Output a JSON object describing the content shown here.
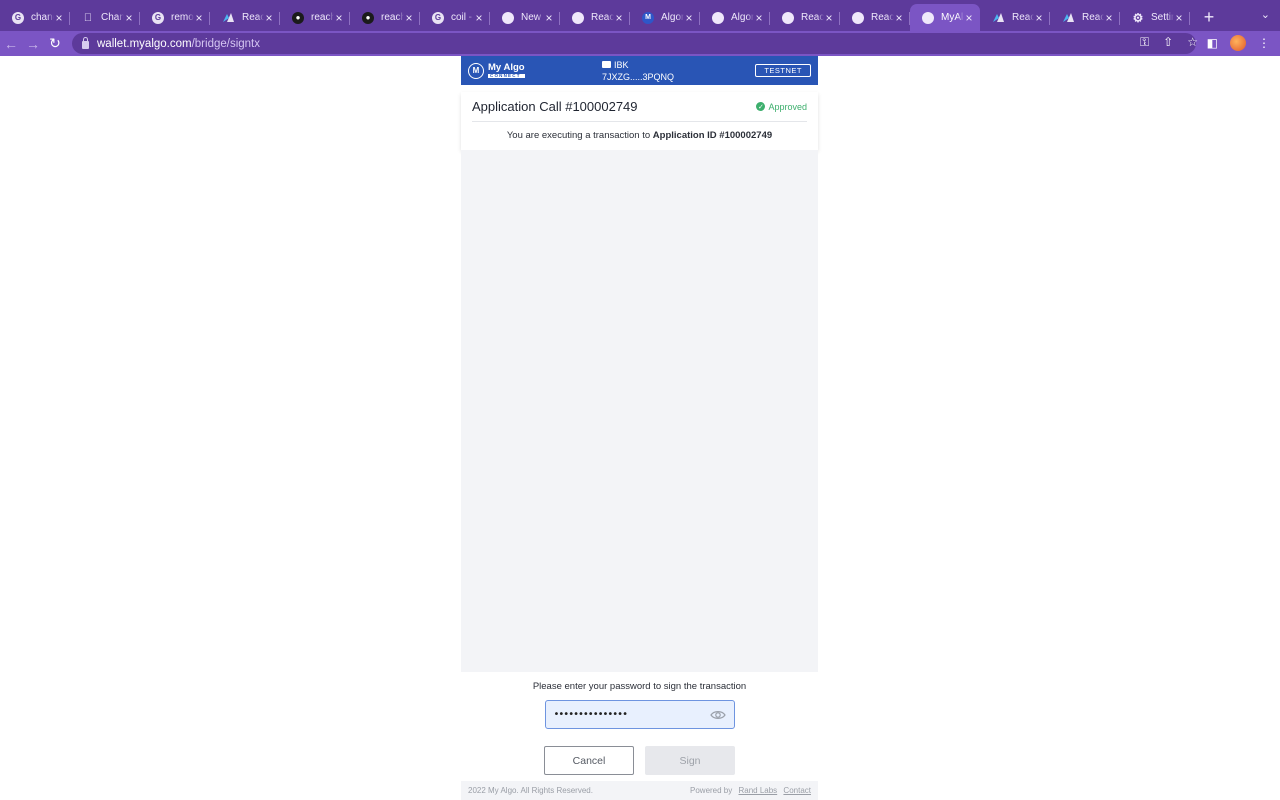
{
  "browser": {
    "tabs": [
      {
        "favicon": "google-icon",
        "title": "chang"
      },
      {
        "favicon": "apple-icon",
        "title": "Chang"
      },
      {
        "favicon": "google-icon",
        "title": "remov"
      },
      {
        "favicon": "reach-icon",
        "title": "Reach"
      },
      {
        "favicon": "github-icon",
        "title": "reach"
      },
      {
        "favicon": "github-icon",
        "title": "reach"
      },
      {
        "favicon": "google-icon",
        "title": "coil -"
      },
      {
        "favicon": "globe-icon",
        "title": "New T"
      },
      {
        "favicon": "globe-icon",
        "title": "Reach"
      },
      {
        "favicon": "algo-icon",
        "title": "Algor"
      },
      {
        "favicon": "globe-icon",
        "title": "Algor"
      },
      {
        "favicon": "globe-icon",
        "title": "Reach"
      },
      {
        "favicon": "globe-icon",
        "title": "Reach"
      },
      {
        "favicon": "globe-icon",
        "title": "MyAlg",
        "active": true
      },
      {
        "favicon": "reach-icon",
        "title": "Reach"
      },
      {
        "favicon": "reach-icon",
        "title": "Reach"
      },
      {
        "favicon": "gear-icon",
        "title": "Settin"
      }
    ],
    "url_host": "wallet.myalgo.com",
    "url_path": "/bridge/signtx",
    "theme": {
      "tabstrip": "#5d3a9b",
      "toolbar": "#7b55c4"
    }
  },
  "popup": {
    "logo_name": "My Algo",
    "logo_sub": "CONNECT",
    "account_name": "IBK",
    "account_address": "7JXZG.....3PQNQ",
    "network": "TESTNET",
    "transaction": {
      "title": "Application Call #100002749",
      "status": "Approved",
      "description_prefix": "You are executing a transaction to ",
      "description_target": "Application ID #100002749"
    },
    "sign": {
      "prompt": "Please enter your password to sign the transaction",
      "password_mask": "•••••••••••••••",
      "cancel_label": "Cancel",
      "sign_label": "Sign"
    },
    "footer": {
      "copyright": "2022 My Algo. All Rights Reserved.",
      "powered_by": "Powered by",
      "rand_labs": "Rand Labs",
      "contact": "Contact"
    },
    "colors": {
      "brand": "#2955b5",
      "approved": "#3daf6d"
    }
  }
}
